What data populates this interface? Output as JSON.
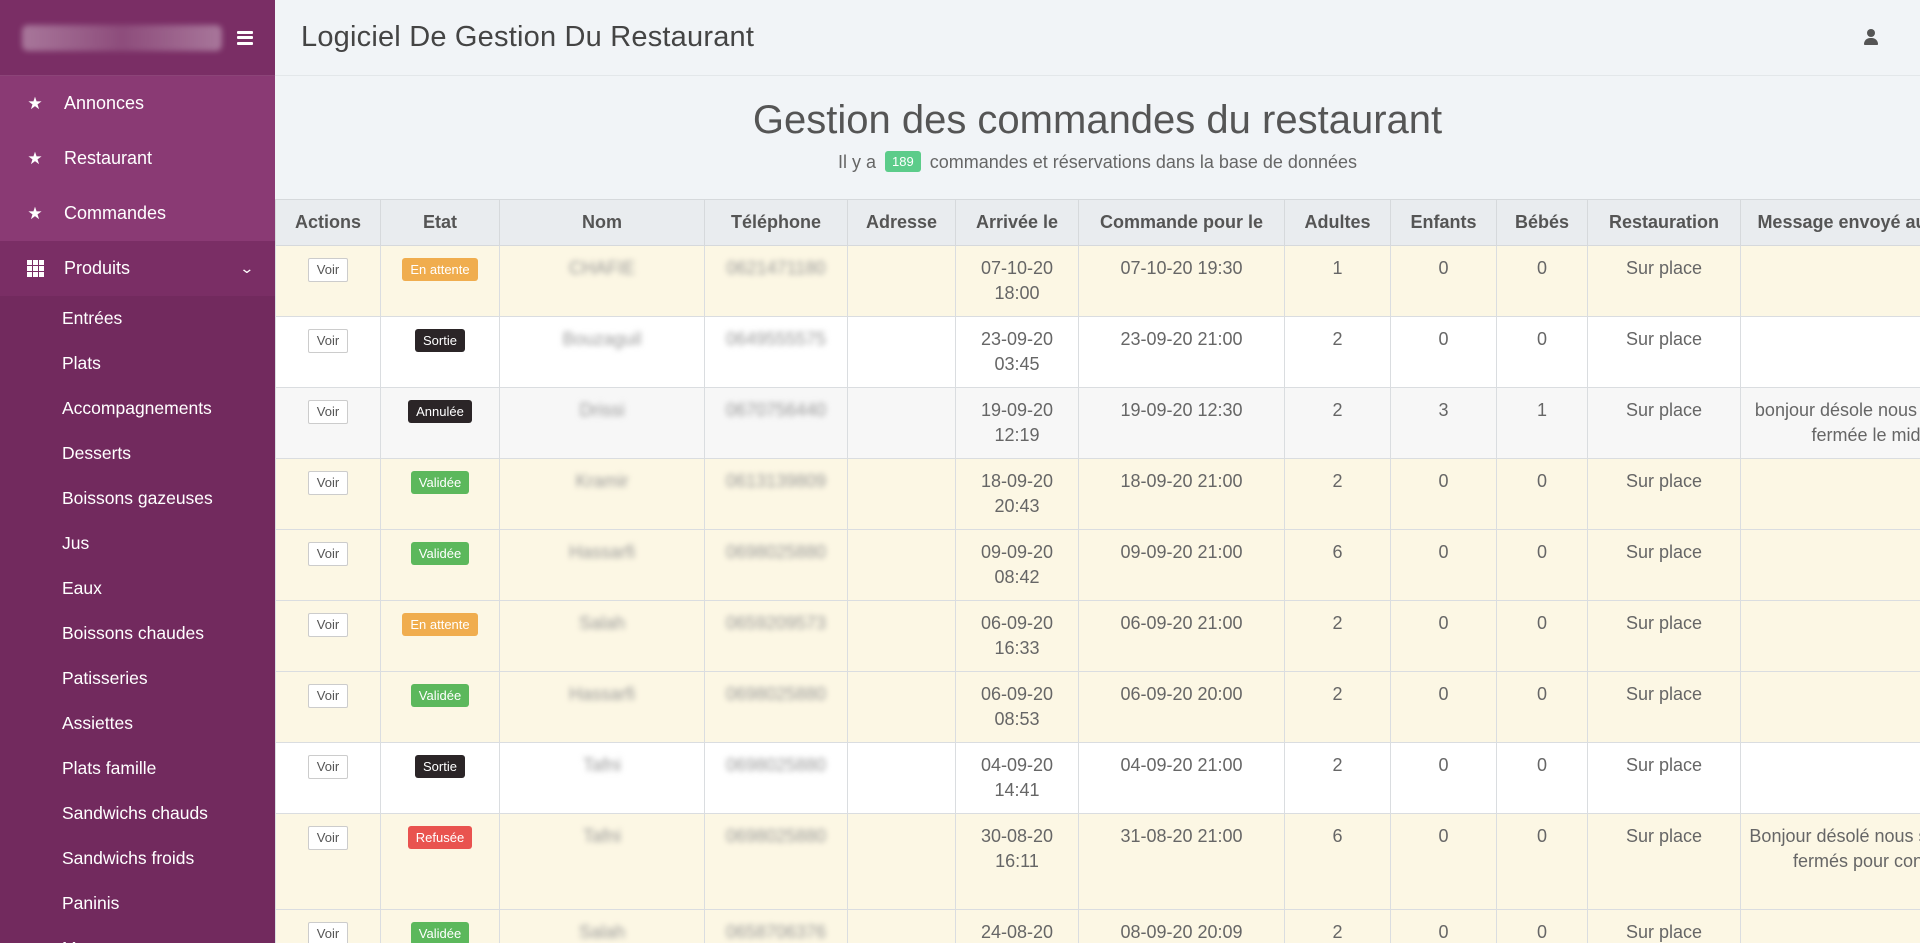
{
  "app_title": "Logiciel De Gestion Du Restaurant",
  "sidebar": {
    "brand_blurred": "La Gourmandise",
    "main_items": [
      {
        "label": "Annonces",
        "icon": "star-icon"
      },
      {
        "label": "Restaurant",
        "icon": "star-icon"
      },
      {
        "label": "Commandes",
        "icon": "star-icon"
      }
    ],
    "produits": {
      "label": "Produits",
      "icon": "grid-icon"
    },
    "sub_items": [
      "Entrées",
      "Plats",
      "Accompagnements",
      "Desserts",
      "Boissons gazeuses",
      "Jus",
      "Eaux",
      "Boissons chaudes",
      "Patisseries",
      "Assiettes",
      "Plats famille",
      "Sandwichs chauds",
      "Sandwichs froids",
      "Paninis",
      "Menus"
    ]
  },
  "page": {
    "heading": "Gestion des commandes du restaurant",
    "sub_prefix": "Il y a",
    "count": "189",
    "sub_suffix": "commandes et réservations dans la base de données"
  },
  "table": {
    "columns": [
      "Actions",
      "Etat",
      "Nom",
      "Téléphone",
      "Adresse",
      "Arrivée le",
      "Commande pour le",
      "Adultes",
      "Enfants",
      "Bébés",
      "Restauration",
      "Message envoyé au client"
    ],
    "action_label": "Voir",
    "rows": [
      {
        "etat": "En attente",
        "etat_color": "#f0ad4e",
        "nom": "CHAFIE",
        "tel": "0621471180",
        "adresse": "",
        "arrivee1": "07-10-20",
        "arrivee2": "18:00",
        "commande": "07-10-20 19:30",
        "adultes": "1",
        "enfants": "0",
        "bebes": "0",
        "restauration": "Sur place",
        "message": "",
        "bg": "warn"
      },
      {
        "etat": "Sortie",
        "etat_color": "#2b2527",
        "nom": "Bouzaguil",
        "tel": "0649555575",
        "adresse": "",
        "arrivee1": "23-09-20",
        "arrivee2": "03:45",
        "commande": "23-09-20 21:00",
        "adultes": "2",
        "enfants": "0",
        "bebes": "0",
        "restauration": "Sur place",
        "message": "",
        "bg": "white"
      },
      {
        "etat": "Annulée",
        "etat_color": "#2b2527",
        "nom": "Drissi",
        "tel": "0670756440",
        "adresse": "",
        "arrivee1": "19-09-20",
        "arrivee2": "12:19",
        "commande": "19-09-20 12:30",
        "adultes": "2",
        "enfants": "3",
        "bebes": "1",
        "restauration": "Sur place",
        "message": "bonjour désole nous somme fermée le midi",
        "bg": "grey"
      },
      {
        "etat": "Validée",
        "etat_color": "#5cb85c",
        "nom": "Kramir",
        "tel": "0613139809",
        "adresse": "",
        "arrivee1": "18-09-20",
        "arrivee2": "20:43",
        "commande": "18-09-20 21:00",
        "adultes": "2",
        "enfants": "0",
        "bebes": "0",
        "restauration": "Sur place",
        "message": "",
        "bg": "warn"
      },
      {
        "etat": "Validée",
        "etat_color": "#5cb85c",
        "nom": "Hassarfi",
        "tel": "0698025880",
        "adresse": "",
        "arrivee1": "09-09-20",
        "arrivee2": "08:42",
        "commande": "09-09-20 21:00",
        "adultes": "6",
        "enfants": "0",
        "bebes": "0",
        "restauration": "Sur place",
        "message": "",
        "bg": "warn"
      },
      {
        "etat": "En attente",
        "etat_color": "#f0ad4e",
        "nom": "Salah",
        "tel": "0659209573",
        "adresse": "",
        "arrivee1": "06-09-20",
        "arrivee2": "16:33",
        "commande": "06-09-20 21:00",
        "adultes": "2",
        "enfants": "0",
        "bebes": "0",
        "restauration": "Sur place",
        "message": "",
        "bg": "warn"
      },
      {
        "etat": "Validée",
        "etat_color": "#5cb85c",
        "nom": "Hassarfi",
        "tel": "0698025880",
        "adresse": "",
        "arrivee1": "06-09-20",
        "arrivee2": "08:53",
        "commande": "06-09-20 20:00",
        "adultes": "2",
        "enfants": "0",
        "bebes": "0",
        "restauration": "Sur place",
        "message": "",
        "bg": "warn"
      },
      {
        "etat": "Sortie",
        "etat_color": "#2b2527",
        "nom": "Tafni",
        "tel": "0698025880",
        "adresse": "",
        "arrivee1": "04-09-20",
        "arrivee2": "14:41",
        "commande": "04-09-20 21:00",
        "adultes": "2",
        "enfants": "0",
        "bebes": "0",
        "restauration": "Sur place",
        "message": "",
        "bg": "white"
      },
      {
        "etat": "Refusée",
        "etat_color": "#e9534f",
        "nom": "Tafni",
        "tel": "0698025880",
        "adresse": "",
        "arrivee1": "30-08-20",
        "arrivee2": "16:11",
        "commande": "31-08-20 21:00",
        "adultes": "6",
        "enfants": "0",
        "bebes": "0",
        "restauration": "Sur place",
        "message": "Bonjour désolé nous sommes fermés pour congé",
        "bg": "warn",
        "tall": true
      },
      {
        "etat": "Validée",
        "etat_color": "#5cb85c",
        "nom": "Salah",
        "tel": "0658706376",
        "adresse": "",
        "arrivee1": "24-08-20",
        "arrivee2": "",
        "commande": "08-09-20 20:09",
        "adultes": "2",
        "enfants": "0",
        "bebes": "0",
        "restauration": "Sur place",
        "message": "",
        "bg": "warn"
      }
    ]
  }
}
